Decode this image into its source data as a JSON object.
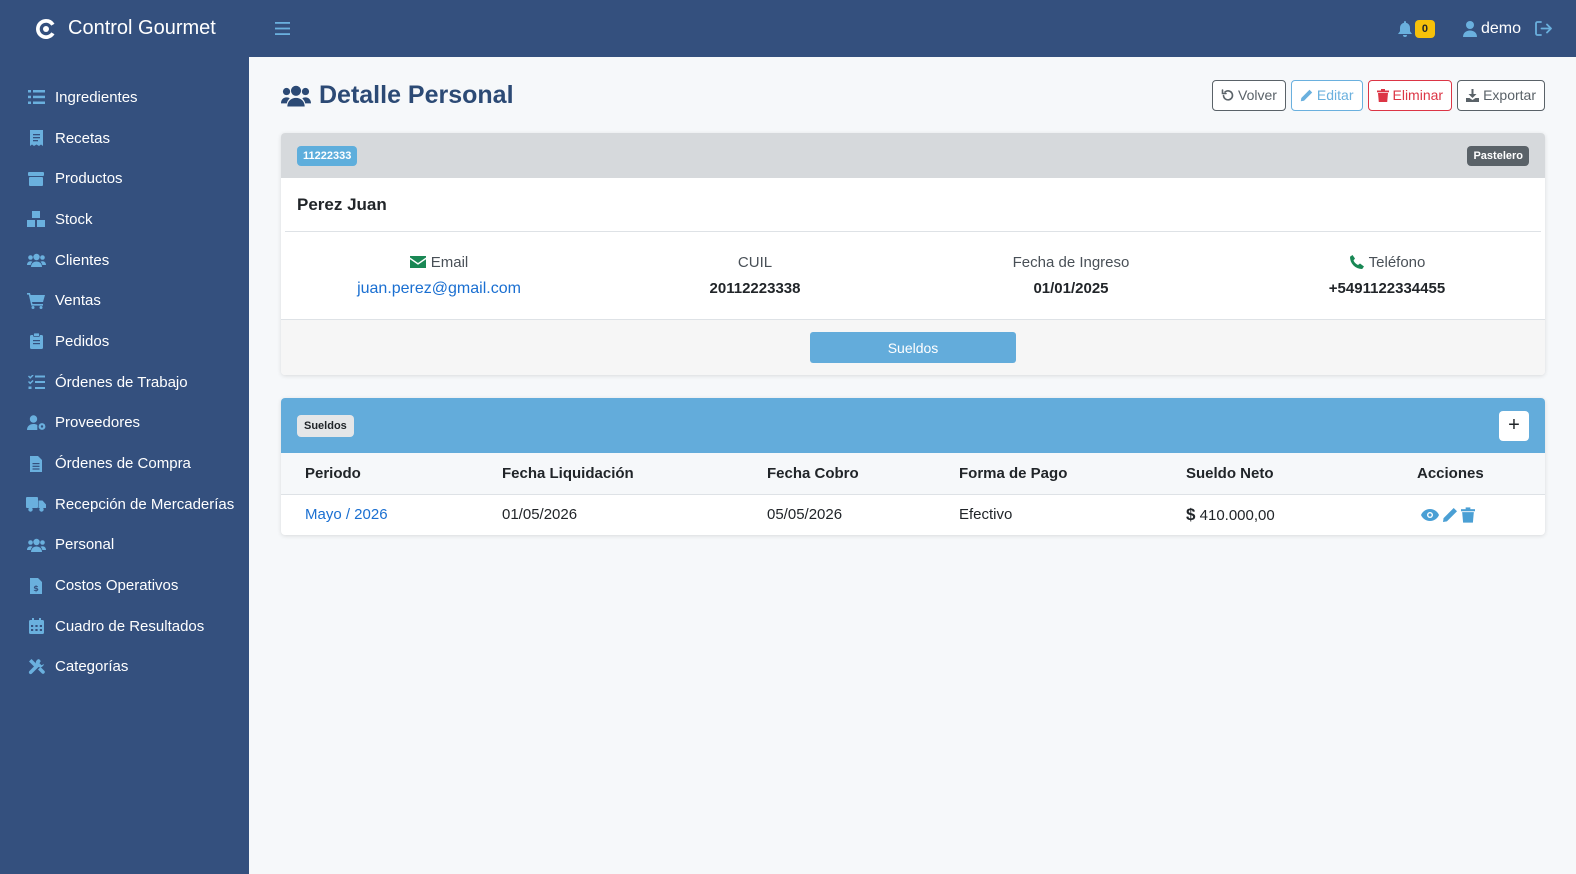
{
  "app": {
    "title": "Control Gourmet"
  },
  "colors": {
    "sidebar": "#34507e",
    "accent": "#63acdb",
    "danger": "#dc3545",
    "warning": "#f6c10a"
  },
  "sidebar": {
    "items": [
      {
        "label": "Ingredientes",
        "icon": "list-icon"
      },
      {
        "label": "Recetas",
        "icon": "receipt-icon"
      },
      {
        "label": "Productos",
        "icon": "box-icon"
      },
      {
        "label": "Stock",
        "icon": "boxes-icon"
      },
      {
        "label": "Clientes",
        "icon": "users-icon"
      },
      {
        "label": "Ventas",
        "icon": "cart-icon"
      },
      {
        "label": "Pedidos",
        "icon": "clipboard-icon"
      },
      {
        "label": "Órdenes de Trabajo",
        "icon": "list-check-icon"
      },
      {
        "label": "Proveedores",
        "icon": "user-gear-icon"
      },
      {
        "label": "Órdenes de Compra",
        "icon": "file-lines-icon"
      },
      {
        "label": "Recepción de Mercaderías",
        "icon": "truck-icon"
      },
      {
        "label": "Personal",
        "icon": "users-icon"
      },
      {
        "label": "Costos Operativos",
        "icon": "file-invoice-dollar-icon"
      },
      {
        "label": "Cuadro de Resultados",
        "icon": "calendar-icon"
      },
      {
        "label": "Categorías",
        "icon": "tools-icon"
      }
    ]
  },
  "topbar": {
    "notifications": "0",
    "user": "demo"
  },
  "page": {
    "title": "Detalle Personal",
    "actions": {
      "volver": "Volver",
      "editar": "Editar",
      "eliminar": "Eliminar",
      "exportar": "Exportar"
    }
  },
  "employee": {
    "id": "11222333",
    "role": "Pastelero",
    "name": "Perez Juan",
    "email_label": "Email",
    "email": "juan.perez@gmail.com",
    "cuil_label": "CUIL",
    "cuil": "20112223338",
    "ingreso_label": "Fecha de Ingreso",
    "ingreso": "01/01/2025",
    "telefono_label": "Teléfono",
    "telefono": "+5491122334455",
    "sueldos_button": "Sueldos"
  },
  "sueldos": {
    "badge": "Sueldos",
    "add_label": "+",
    "columns": [
      "Periodo",
      "Fecha Liquidación",
      "Fecha Cobro",
      "Forma de Pago",
      "Sueldo Neto",
      "Acciones"
    ],
    "rows": [
      {
        "periodo": "Mayo / 2026",
        "liquidacion": "01/05/2026",
        "cobro": "05/05/2026",
        "forma": "Efectivo",
        "currency": "$",
        "neto": "410.000,00"
      }
    ]
  }
}
